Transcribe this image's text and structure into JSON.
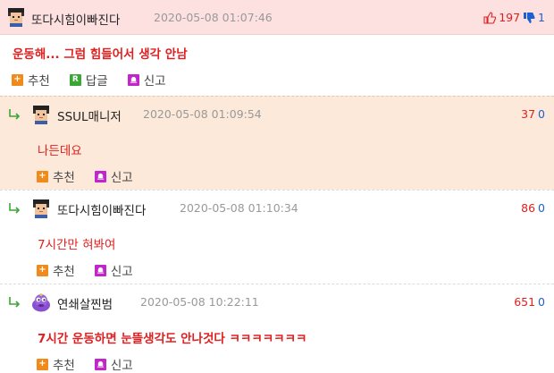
{
  "labels": {
    "recommend": "추천",
    "reply": "답글",
    "report": "신고"
  },
  "comments": [
    {
      "nick": "또다시힘이빠진다",
      "date": "2020-05-08 01:07:46",
      "up": "197",
      "down": "1",
      "text": "운동해... 그럼 힘들어서 생각 안남"
    },
    {
      "nick": "SSUL매니저",
      "date": "2020-05-08 01:09:54",
      "up": "37",
      "down": "0",
      "text": "나든데요"
    },
    {
      "nick": "또다시힘이빠진다",
      "date": "2020-05-08 01:10:34",
      "up": "86",
      "down": "0",
      "text": "7시간만 혀봐여"
    },
    {
      "nick": "연쇄살찐범",
      "date": "2020-05-08 10:22:11",
      "up": "651",
      "down": "0",
      "text": "7시간 운동하면 눈뜰생각도 안나것다 ㅋㅋㅋㅋㅋㅋㅋ"
    }
  ],
  "icons": {
    "avatar_default": "pixel-student-avatar",
    "avatar_special": "purple-blob-avatar",
    "reply_arrow": "reply-arrow-icon",
    "thumb_up": "thumbs-up-icon",
    "thumb_down": "thumbs-down-icon",
    "recommend_glyph": "+",
    "reply_glyph": "R",
    "report_glyph": "bell-icon"
  },
  "colors": {
    "up": "#e02020",
    "down": "#1f5fd0",
    "accent_text": "#e02020",
    "reply_bg": "#fde9d9",
    "top_header_bg": "#fde1e1"
  }
}
